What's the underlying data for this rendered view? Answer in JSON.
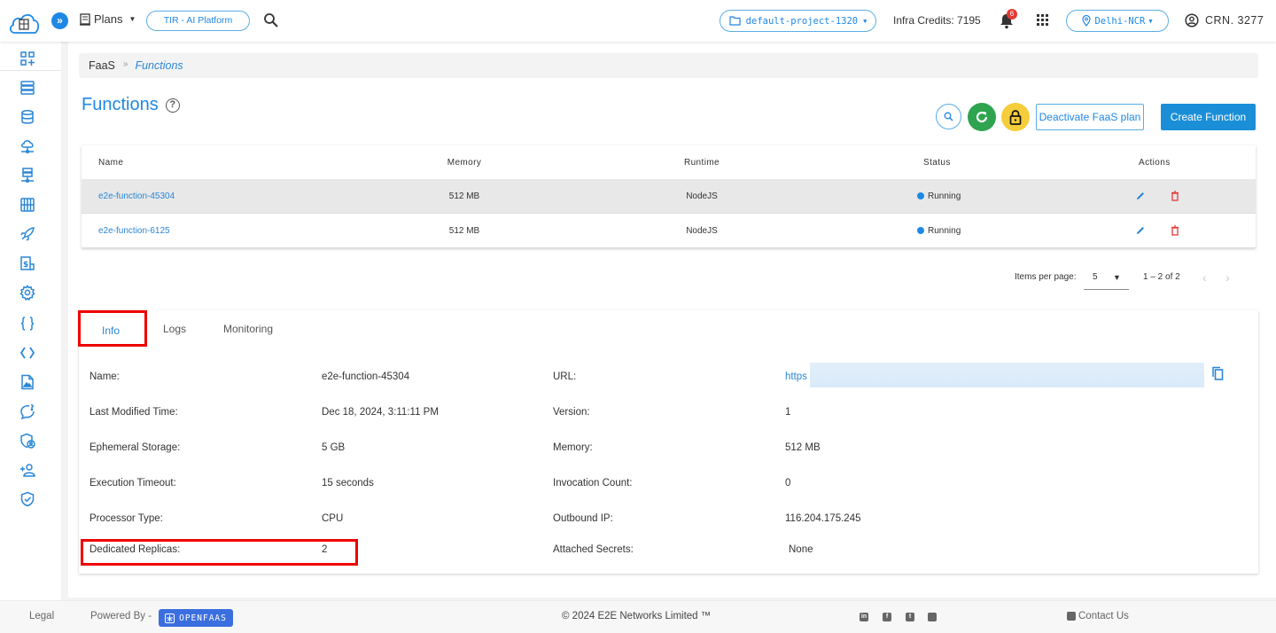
{
  "topbar": {
    "plans_label": "Plans",
    "platform_pill": "TIR - AI Platform",
    "project": "default-project-1320",
    "infra_credits": "Infra Credits: 7195",
    "notification_count": "6",
    "region": "Delhi-NCR",
    "crn": "CRN. 3277"
  },
  "sidebar": {
    "items": [
      {
        "icon": "dashboard-add-icon"
      },
      {
        "icon": "server-icon"
      },
      {
        "icon": "database-icon"
      },
      {
        "icon": "cloud-network-icon"
      },
      {
        "icon": "network-server-icon"
      },
      {
        "icon": "storage-grid-icon"
      },
      {
        "icon": "rocket-icon"
      },
      {
        "icon": "billing-icon"
      },
      {
        "icon": "settings-icon"
      },
      {
        "icon": "curly-braces-icon"
      },
      {
        "icon": "code-icon"
      },
      {
        "icon": "image-file-icon"
      },
      {
        "icon": "support-chat-icon"
      },
      {
        "icon": "security-user-icon"
      },
      {
        "icon": "add-user-icon"
      },
      {
        "icon": "shield-check-icon"
      }
    ]
  },
  "breadcrumb": {
    "parent": "FaaS",
    "separator": "»",
    "current": "Functions"
  },
  "page": {
    "title": "Functions",
    "help": "?",
    "deactivate_label": "Deactivate FaaS plan",
    "create_label": "Create Function"
  },
  "table": {
    "headers": {
      "name": "Name",
      "memory": "Memory",
      "runtime": "Runtime",
      "status": "Status",
      "actions": "Actions"
    },
    "rows": [
      {
        "name": "e2e-function-45304",
        "memory": "512 MB",
        "runtime": "NodeJS",
        "status": "Running"
      },
      {
        "name": "e2e-function-6125",
        "memory": "512 MB",
        "runtime": "NodeJS",
        "status": "Running"
      }
    ]
  },
  "paginator": {
    "items_per_page_label": "Items per page:",
    "items_per_page": "5",
    "range": "1 – 2 of 2"
  },
  "tabs": {
    "info": "Info",
    "logs": "Logs",
    "monitoring": "Monitoring"
  },
  "info": {
    "left": [
      {
        "label": "Name:",
        "value": "e2e-function-45304"
      },
      {
        "label": "Last Modified Time:",
        "value": "Dec 18, 2024, 3:11:11 PM"
      },
      {
        "label": "Ephemeral Storage:",
        "value": "5 GB"
      },
      {
        "label": "Execution Timeout:",
        "value": "15 seconds"
      },
      {
        "label": "Processor Type:",
        "value": "CPU"
      },
      {
        "label": "Dedicated Replicas:",
        "value": "2"
      }
    ],
    "right": [
      {
        "label": "URL:",
        "value": "https"
      },
      {
        "label": "Version:",
        "value": "1"
      },
      {
        "label": "Memory:",
        "value": "512 MB"
      },
      {
        "label": "Invocation Count:",
        "value": "0"
      },
      {
        "label": "Outbound IP:",
        "value": "116.204.175.245"
      },
      {
        "label": "Attached Secrets:",
        "value": "None"
      }
    ]
  },
  "footer": {
    "legal": "Legal",
    "powered_by": "Powered By -",
    "openfaas": "OPENFAAS",
    "copyright": "© 2024 E2E Networks Limited ™",
    "contact": "Contact Us",
    "social": [
      "in",
      "f",
      "t",
      "rss"
    ]
  },
  "colors": {
    "accent": "#1e88e5",
    "success": "#2ea44f",
    "warning": "#f5cd3a",
    "danger": "#e53935",
    "highlight": "#ee0000"
  }
}
